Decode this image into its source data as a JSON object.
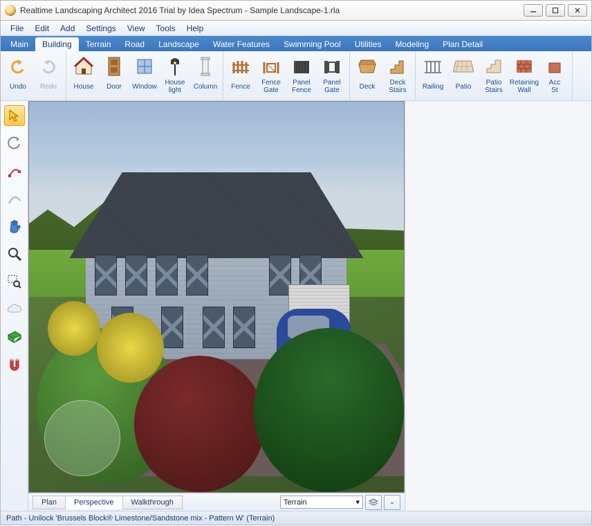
{
  "window": {
    "title": "Realtime Landscaping Architect 2016 Trial by Idea Spectrum - Sample Landscape-1.rla"
  },
  "menu": {
    "items": [
      "File",
      "Edit",
      "Add",
      "Settings",
      "View",
      "Tools",
      "Help"
    ]
  },
  "ribbon": {
    "tabs": [
      "Main",
      "Building",
      "Terrain",
      "Road",
      "Landscape",
      "Water Features",
      "Swimming Pool",
      "Utilities",
      "Modeling",
      "Plan Detail"
    ],
    "active": "Building"
  },
  "toolbar": {
    "groups": [
      {
        "items": [
          {
            "id": "undo",
            "label": "Undo",
            "icon": "undo-icon",
            "enabled": true
          },
          {
            "id": "redo",
            "label": "Redo",
            "icon": "redo-icon",
            "enabled": false
          }
        ]
      },
      {
        "items": [
          {
            "id": "house",
            "label": "House",
            "icon": "house-icon",
            "enabled": true
          },
          {
            "id": "door",
            "label": "Door",
            "icon": "door-icon",
            "enabled": true
          },
          {
            "id": "window",
            "label": "Window",
            "icon": "window-icon",
            "enabled": true
          },
          {
            "id": "houselight",
            "label": "House light",
            "icon": "lamp-icon",
            "enabled": true
          },
          {
            "id": "column",
            "label": "Column",
            "icon": "column-icon",
            "enabled": true
          }
        ]
      },
      {
        "items": [
          {
            "id": "fence",
            "label": "Fence",
            "icon": "fence-icon",
            "enabled": true
          },
          {
            "id": "fencegate",
            "label": "Fence Gate",
            "icon": "fence-gate-icon",
            "enabled": true
          },
          {
            "id": "panelfence",
            "label": "Panel Fence",
            "icon": "panel-fence-icon",
            "enabled": true
          },
          {
            "id": "panelgate",
            "label": "Panel Gate",
            "icon": "panel-gate-icon",
            "enabled": true
          }
        ]
      },
      {
        "items": [
          {
            "id": "deck",
            "label": "Deck",
            "icon": "deck-icon",
            "enabled": true
          },
          {
            "id": "deckstairs",
            "label": "Deck Stairs",
            "icon": "deck-stairs-icon",
            "enabled": true
          }
        ]
      },
      {
        "items": [
          {
            "id": "railing",
            "label": "Railing",
            "icon": "railing-icon",
            "enabled": true
          },
          {
            "id": "patio",
            "label": "Patio",
            "icon": "patio-icon",
            "enabled": true
          },
          {
            "id": "patiostairs",
            "label": "Patio Stairs",
            "icon": "patio-stairs-icon",
            "enabled": true
          },
          {
            "id": "retainingwall",
            "label": "Retaining Wall",
            "icon": "retaining-wall-icon",
            "enabled": true
          },
          {
            "id": "acc",
            "label": "Acc St",
            "icon": "accessory-icon",
            "enabled": true
          }
        ]
      }
    ]
  },
  "palette": {
    "tools": [
      {
        "id": "select",
        "name": "select-tool-icon",
        "active": true
      },
      {
        "id": "orbit",
        "name": "orbit-icon",
        "active": false
      },
      {
        "id": "edit-point",
        "name": "edit-point-icon",
        "active": false
      },
      {
        "id": "curve",
        "name": "curve-tool-icon",
        "active": false
      },
      {
        "id": "pan",
        "name": "pan-hand-icon",
        "active": false
      },
      {
        "id": "zoom",
        "name": "zoom-icon",
        "active": false
      },
      {
        "id": "zoom-region",
        "name": "zoom-region-icon",
        "active": false
      },
      {
        "id": "cloud",
        "name": "cloud-icon",
        "active": false
      },
      {
        "id": "grid",
        "name": "grid-icon",
        "active": false
      },
      {
        "id": "snap",
        "name": "magnet-icon",
        "active": false
      }
    ]
  },
  "viewbar": {
    "tabs": [
      "Plan",
      "Perspective",
      "Walkthrough"
    ],
    "active": "Perspective",
    "layer_select": "Terrain"
  },
  "statusbar": {
    "text": "Path - Unilock 'Brussels Block® Limestone/Sandstone mix - Pattern W' (Terrain)"
  }
}
